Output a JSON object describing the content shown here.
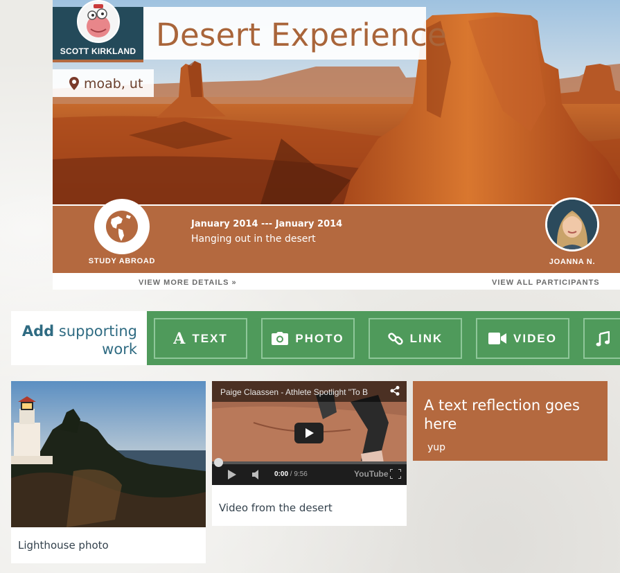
{
  "experience": {
    "author": "SCOTT KIRKLAND",
    "title": "Desert Experience",
    "location": "moab, ut",
    "category": "STUDY ABROAD",
    "dates": "January 2014 --- January 2014",
    "subtitle": "Hanging out in the desert",
    "partner": "JOANNA N.",
    "view_more": "VIEW MORE DETAILS »",
    "view_all": "VIEW ALL PARTICIPANTS"
  },
  "add_work": {
    "bold": "Add",
    "line1_rest": " supporting",
    "line2": "work",
    "buttons": [
      {
        "label": "TEXT",
        "icon": "text-icon"
      },
      {
        "label": "PHOTO",
        "icon": "camera-icon"
      },
      {
        "label": "LINK",
        "icon": "link-icon"
      },
      {
        "label": "VIDEO",
        "icon": "video-camera-icon"
      },
      {
        "label": "AUDIO",
        "icon": "music-icon"
      }
    ]
  },
  "cards": {
    "photo_caption": "Lighthouse photo",
    "video": {
      "title": "Paige Claassen - Athlete Spotlight \"To B",
      "time_current": "0:00",
      "time_total": " / 9:56",
      "logo": "YouTube",
      "caption": "Video from the desert"
    },
    "text": {
      "title": "A text reflection goes here",
      "body": "yup"
    }
  },
  "colors": {
    "accent_orange": "#b4693f",
    "title_orange": "#a9653a",
    "navy": "#244a5a",
    "green": "#4f9a5b",
    "green_border": "#8fc79a",
    "link_blue": "#2f6b82"
  }
}
